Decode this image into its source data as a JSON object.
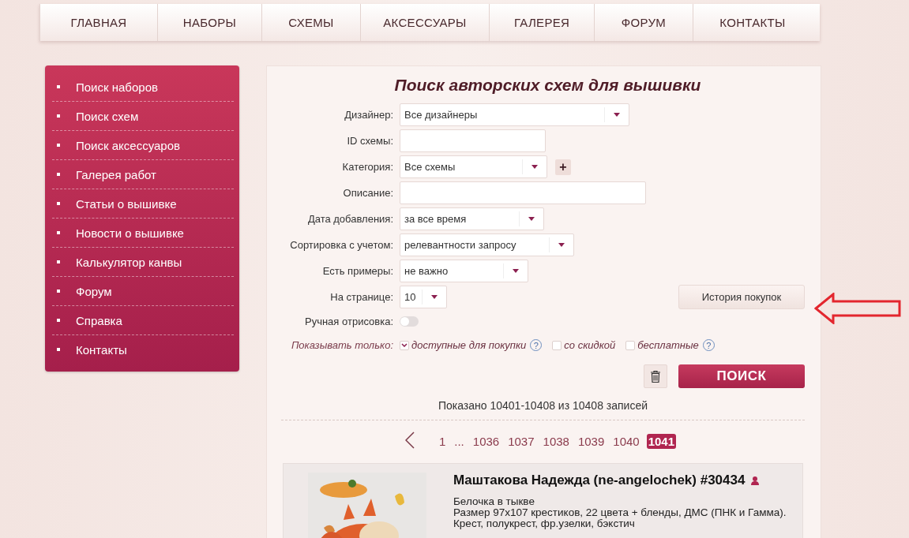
{
  "nav": [
    "ГЛАВНАЯ",
    "НАБОРЫ",
    "СХЕМЫ",
    "АКСЕССУАРЫ",
    "ГАЛЕРЕЯ",
    "ФОРУМ",
    "КОНТАКТЫ"
  ],
  "sidebar": {
    "items": [
      "Поиск наборов",
      "Поиск схем",
      "Поиск аксессуаров",
      "Галерея работ",
      "Статьи о вышивке",
      "Новости о вышивке",
      "Калькулятор канвы",
      "Форум",
      "Справка",
      "Контакты"
    ]
  },
  "search": {
    "title": "Поиск авторских схем для вышивки",
    "fields": [
      {
        "kind": "select",
        "label": "Дизайнер:",
        "value": "Все дизайнеры"
      },
      {
        "kind": "input",
        "label": "ID схемы:"
      },
      {
        "kind": "select",
        "label": "Категория:",
        "value": "Все схемы",
        "add_button": "+"
      },
      {
        "kind": "input",
        "label": "Описание:"
      },
      {
        "kind": "select",
        "label": "Дата добавления:",
        "value": "за все время"
      },
      {
        "kind": "select",
        "label": "Сортировка с учетом:",
        "value": "релевантности запросу"
      },
      {
        "kind": "select",
        "label": "Есть примеры:",
        "value": "не важно"
      },
      {
        "kind": "select",
        "label": "На странице:",
        "value": "10",
        "side_button": "История покупок"
      },
      {
        "kind": "toggle",
        "label": "Ручная отрисовка:",
        "on": false
      }
    ],
    "filter": {
      "label": "Показывать только:",
      "options": [
        {
          "label": "доступные для покупки",
          "checked": true,
          "help": "?"
        },
        {
          "label": "со скидкой",
          "checked": false
        },
        {
          "label": "бесплатные",
          "checked": false,
          "help": "?"
        }
      ]
    },
    "search_button": "ПОИСК"
  },
  "summary": "Показано 10401-10408 из 10408 записей",
  "pagination": [
    {
      "label": "1",
      "selected": false
    },
    {
      "label": "...",
      "selected": false
    },
    {
      "label": "1036",
      "selected": false
    },
    {
      "label": "1037",
      "selected": false
    },
    {
      "label": "1038",
      "selected": false
    },
    {
      "label": "1039",
      "selected": false
    },
    {
      "label": "1040",
      "selected": false
    },
    {
      "label": "1041",
      "selected": true
    }
  ],
  "results": [
    {
      "title": "Маштакова Надежда (ne-angelochek) #30434",
      "lines": [
        "Белочка в тыкве",
        "Размер 97x107 крестиков, 22 цвета + бленды, ДМС (ПНК и Гамма).",
        "Крест, полукрест, фр.узелки, бэкстич"
      ]
    }
  ]
}
